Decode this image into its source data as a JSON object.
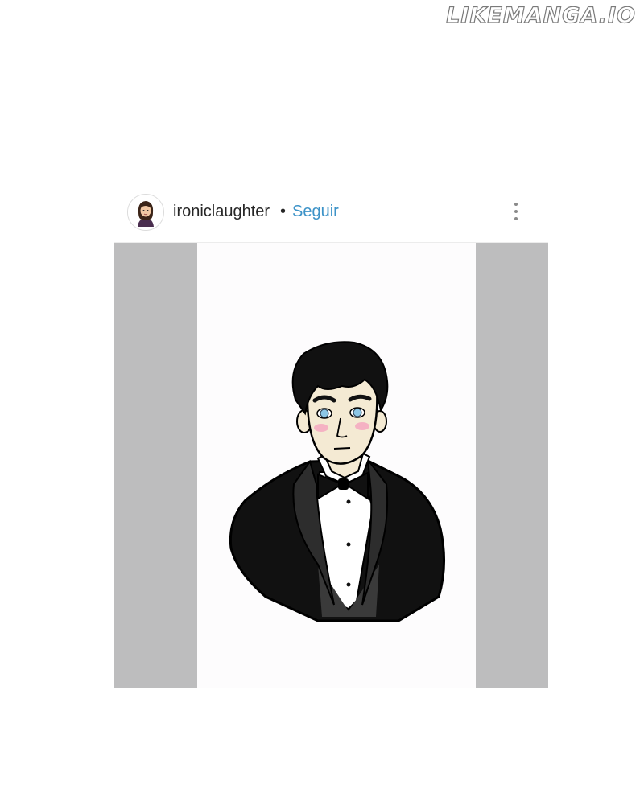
{
  "watermark": "LIKEMANGA.IO",
  "post": {
    "username": "ironiclaughter",
    "separator": "•",
    "follow_label": "Seguir"
  },
  "icons": {
    "avatar": "avatar",
    "more_options": "vertical-ellipsis-icon"
  },
  "colors": {
    "follow": "#3d93c8",
    "media_background": "#bdbdbe"
  }
}
